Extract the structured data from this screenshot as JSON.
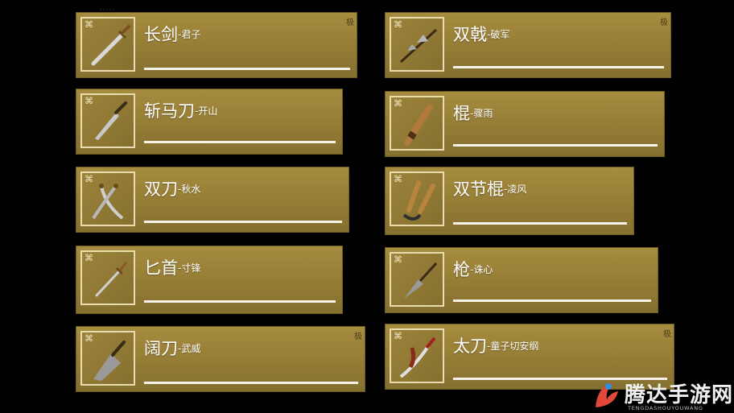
{
  "weapons": [
    {
      "name": "长剑",
      "sub": "-君子",
      "tag": "极"
    },
    {
      "name": "斩马刀",
      "sub": "-开山",
      "tag": ""
    },
    {
      "name": "双刀",
      "sub": "-秋水",
      "tag": ""
    },
    {
      "name": "匕首",
      "sub": "-寸锋",
      "tag": ""
    },
    {
      "name": "阔刀",
      "sub": "-武威",
      "tag": "极"
    },
    {
      "name": "双戟",
      "sub": "-破军",
      "tag": "极"
    },
    {
      "name": "棍",
      "sub": "-骤雨",
      "tag": ""
    },
    {
      "name": "双节棍",
      "sub": "-凌风",
      "tag": ""
    },
    {
      "name": "枪",
      "sub": "-诛心",
      "tag": ""
    },
    {
      "name": "太刀",
      "sub": "-童子切安纲",
      "tag": "极"
    }
  ],
  "top_marker": "·····",
  "watermark": {
    "title": "腾达手游网",
    "subtitle": "TENGDASHOUYOUWANG"
  },
  "colors": {
    "card": "#9c833b",
    "bar": "#f6f2e8",
    "frame": "#e9dcae"
  }
}
